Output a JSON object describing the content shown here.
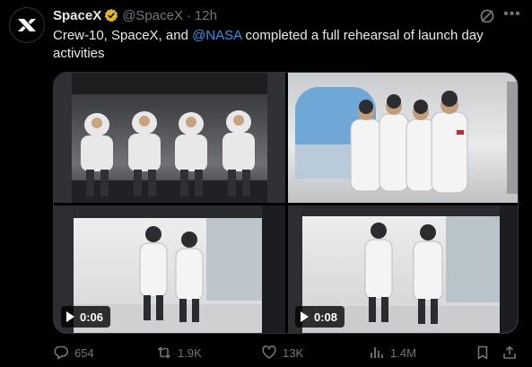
{
  "tweet": {
    "author_name": "SpaceX",
    "handle": "@SpaceX",
    "separator": "·",
    "time": "12h",
    "text_before": "Crew-10, SpaceX, and ",
    "mention": "@NASA",
    "text_after": " completed a full rehearsal of launch day activities"
  },
  "media": {
    "tiles": [
      {
        "kind": "image",
        "icon": "crew-seated-in-capsule"
      },
      {
        "kind": "image",
        "icon": "crew-posing-by-window"
      },
      {
        "kind": "video",
        "duration": "0:06"
      },
      {
        "kind": "video",
        "duration": "0:08"
      }
    ]
  },
  "actions": {
    "replies": "654",
    "reposts": "1.9K",
    "likes": "13K",
    "views": "1.4M"
  },
  "colors": {
    "background": "#000000",
    "text": "#e7e9ea",
    "muted": "#71767b",
    "link": "#1d9bf0",
    "verified_badge": "#e2b719"
  }
}
